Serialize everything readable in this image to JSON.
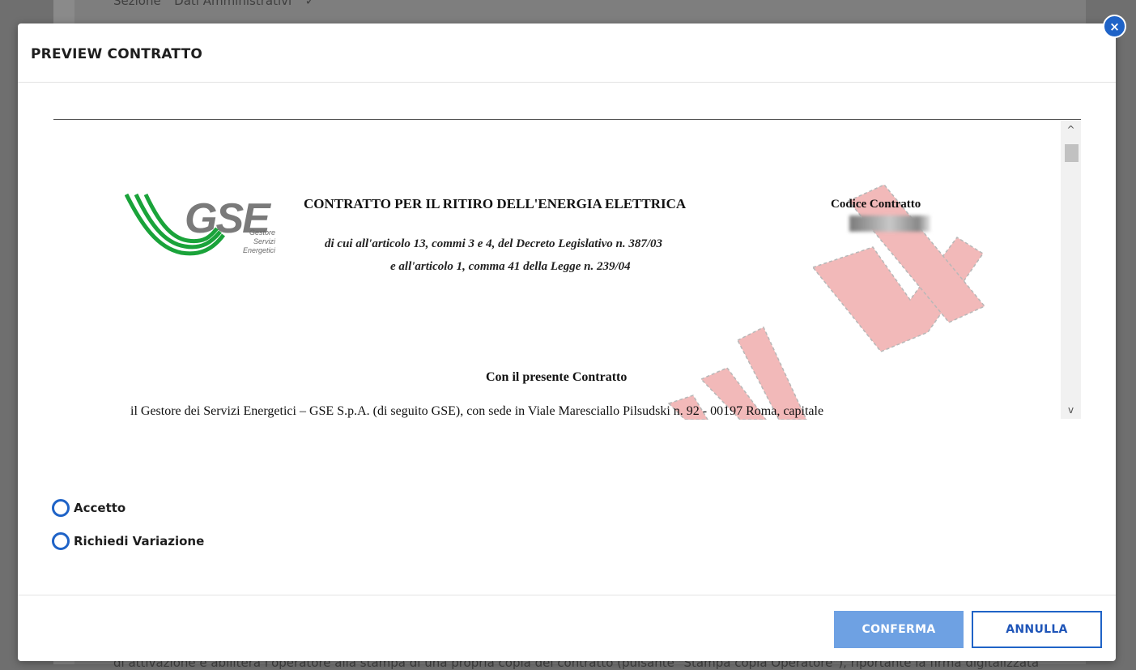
{
  "background": {
    "top_text": "Sezione \" Dati Amministrativi \" ✓",
    "bottom_text": "di attivazione e abiliterà l'operatore alla stampa di una propria copia del contratto (pulsante \"Stampa copia Operatore\"), riportante la firma digitalizzata"
  },
  "modal": {
    "title": "PREVIEW CONTRATTO",
    "close_icon": "×"
  },
  "document": {
    "logo": {
      "text": "GSE",
      "sub": [
        "Gestore",
        "Servizi",
        "Energetici"
      ]
    },
    "title": "CONTRATTO PER IL RITIRO DELL'ENERGIA ELETTRICA",
    "subtitle_1": "di cui all'articolo 13, commi 3 e 4, del Decreto Legislativo n. 387/03",
    "subtitle_2": "e all'articolo 1, comma 41 della Legge n. 239/04",
    "code_label": "Codice Contratto",
    "heading": "Con il presente Contratto",
    "cut_text": "il Gestore dei Servizi Energetici – GSE S.p.A. (di seguito GSE), con sede in Viale Maresciallo Pilsudski n. 92 - 00197 Roma, capitale",
    "watermark": "FACSIMILE"
  },
  "scrollbar": {
    "up_icon": "^",
    "down_icon": "v"
  },
  "options": [
    {
      "label": "Accetto"
    },
    {
      "label": "Richiedi Variazione"
    }
  ],
  "buttons": {
    "confirm": "CONFERMA",
    "cancel": "ANNULLA"
  },
  "colors": {
    "accent": "#1f63c7",
    "confirm_bg": "#6ea1e3",
    "logo_green": "#1aa33a",
    "watermark": "#e8a8a8"
  }
}
